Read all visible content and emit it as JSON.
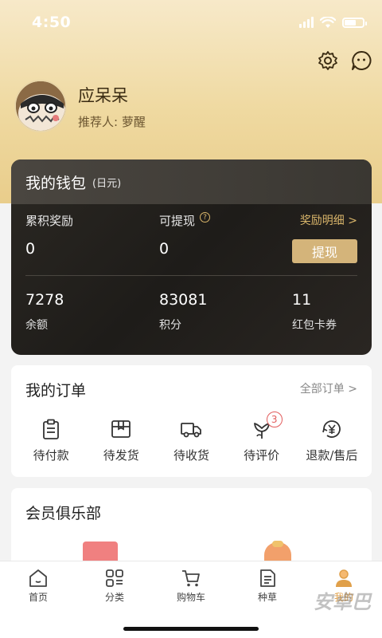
{
  "status_bar": {
    "time": "4:50"
  },
  "profile": {
    "name": "应呆呆",
    "referrer": "推荐人: 萝醒"
  },
  "wallet": {
    "title": "我的钱包",
    "unit": "(日元)",
    "cumulative_label": "累积奖励",
    "cumulative_value": "0",
    "withdrawable_label": "可提现",
    "withdrawable_value": "0",
    "reward_detail_link": "奖励明细 >",
    "withdraw_button": "提现",
    "balance_value": "7278",
    "balance_label": "余额",
    "points_value": "83081",
    "points_label": "积分",
    "coupons_value": "11",
    "coupons_label": "红包卡券"
  },
  "orders": {
    "title": "我的订单",
    "all_link": "全部订单 >",
    "items": [
      {
        "label": "待付款",
        "icon": "clipboard-icon"
      },
      {
        "label": "待发货",
        "icon": "package-icon"
      },
      {
        "label": "待收货",
        "icon": "truck-icon"
      },
      {
        "label": "待评价",
        "icon": "flower-icon",
        "badge": "3"
      },
      {
        "label": "退款/售后",
        "icon": "refund-icon"
      }
    ]
  },
  "club": {
    "title": "会员俱乐部"
  },
  "tabbar": {
    "items": [
      {
        "label": "首页",
        "icon": "home-icon"
      },
      {
        "label": "分类",
        "icon": "category-icon"
      },
      {
        "label": "购物车",
        "icon": "cart-icon"
      },
      {
        "label": "种草",
        "icon": "note-icon"
      },
      {
        "label": "我的",
        "icon": "user-icon",
        "active": true
      }
    ]
  },
  "watermark": "安卓巴",
  "colors": {
    "accent_gold": "#d4b47a",
    "active_tab": "#e0a04a",
    "badge": "#e25c5c"
  }
}
